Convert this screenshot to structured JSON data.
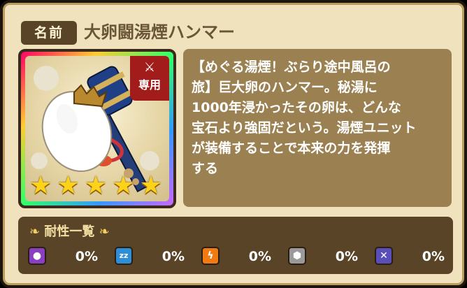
{
  "header": {
    "name_label": "名前",
    "item_name": "大卵闘湯煙ハンマー"
  },
  "item": {
    "badge_label": "専用",
    "rarity_stars": 5,
    "icon": "egg-hammer-icon"
  },
  "description_lines": [
    "【めぐる湯煙！ぶらり途中風呂の",
    "旅】巨大卵のハンマー。秘湯に",
    "1000年浸かったその卵は、どんな",
    "宝石より強固だという。湯煙ユニット",
    "が装備することで本来の力を発揮",
    "する"
  ],
  "resistance": {
    "title": "耐性一覧",
    "items": [
      {
        "icon": "poison-icon",
        "value": "0%",
        "color": "#8a3fc1"
      },
      {
        "icon": "sleep-icon",
        "value": "0%",
        "color": "#2f8fd6"
      },
      {
        "icon": "paralysis-icon",
        "value": "0%",
        "color": "#f07b12"
      },
      {
        "icon": "stone-icon",
        "value": "0%",
        "color": "#9a9a9a"
      },
      {
        "icon": "seal-icon",
        "value": "0%",
        "color": "#5a4fb8"
      }
    ]
  }
}
